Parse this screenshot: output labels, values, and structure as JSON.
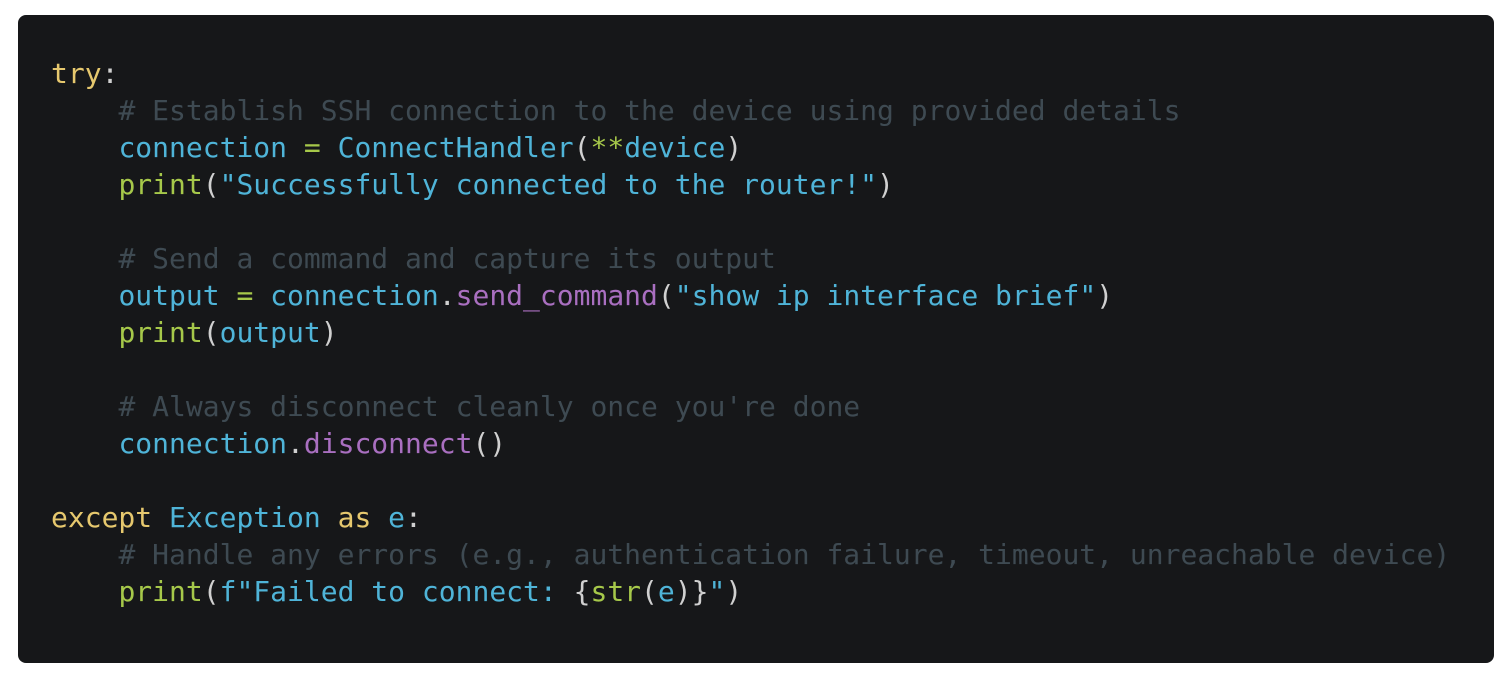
{
  "colors": {
    "background": "#161719",
    "keyword": "#e6c86e",
    "name": "#4fb4d8",
    "string": "#4fb4d8",
    "builtin": "#a6c84a",
    "operator": "#a6c84a",
    "method": "#a96fc0",
    "comment": "#3e4a52",
    "punct": "#d0d0d0"
  },
  "code": {
    "language": "python",
    "lines": [
      [
        [
          "try",
          "keyword"
        ],
        [
          ":",
          "punct"
        ]
      ],
      [
        [
          "    ",
          "punct"
        ],
        [
          "# Establish SSH connection to the device using provided details",
          "comment"
        ]
      ],
      [
        [
          "    ",
          "punct"
        ],
        [
          "connection",
          "name"
        ],
        [
          " ",
          "punct"
        ],
        [
          "=",
          "operator"
        ],
        [
          " ",
          "punct"
        ],
        [
          "ConnectHandler",
          "name"
        ],
        [
          "(",
          "punct"
        ],
        [
          "**",
          "operator"
        ],
        [
          "device",
          "name"
        ],
        [
          ")",
          "punct"
        ]
      ],
      [
        [
          "    ",
          "punct"
        ],
        [
          "print",
          "builtin"
        ],
        [
          "(",
          "punct"
        ],
        [
          "\"Successfully connected to the router!\"",
          "string"
        ],
        [
          ")",
          "punct"
        ]
      ],
      [],
      [
        [
          "    ",
          "punct"
        ],
        [
          "# Send a command and capture its output",
          "comment"
        ]
      ],
      [
        [
          "    ",
          "punct"
        ],
        [
          "output",
          "name"
        ],
        [
          " ",
          "punct"
        ],
        [
          "=",
          "operator"
        ],
        [
          " ",
          "punct"
        ],
        [
          "connection",
          "name"
        ],
        [
          ".",
          "punct"
        ],
        [
          "send_command",
          "method"
        ],
        [
          "(",
          "punct"
        ],
        [
          "\"show ip interface brief\"",
          "string"
        ],
        [
          ")",
          "punct"
        ]
      ],
      [
        [
          "    ",
          "punct"
        ],
        [
          "print",
          "builtin"
        ],
        [
          "(",
          "punct"
        ],
        [
          "output",
          "name"
        ],
        [
          ")",
          "punct"
        ]
      ],
      [],
      [
        [
          "    ",
          "punct"
        ],
        [
          "# Always disconnect cleanly once you're done",
          "comment"
        ]
      ],
      [
        [
          "    ",
          "punct"
        ],
        [
          "connection",
          "name"
        ],
        [
          ".",
          "punct"
        ],
        [
          "disconnect",
          "method"
        ],
        [
          "()",
          "punct"
        ]
      ],
      [],
      [
        [
          "except",
          "keyword"
        ],
        [
          " ",
          "punct"
        ],
        [
          "Exception",
          "name"
        ],
        [
          " ",
          "punct"
        ],
        [
          "as",
          "keyword"
        ],
        [
          " ",
          "punct"
        ],
        [
          "e",
          "name"
        ],
        [
          ":",
          "punct"
        ]
      ],
      [
        [
          "    ",
          "punct"
        ],
        [
          "# Handle any errors (e.g., authentication failure, timeout, unreachable device)",
          "comment"
        ]
      ],
      [
        [
          "    ",
          "punct"
        ],
        [
          "print",
          "builtin"
        ],
        [
          "(",
          "punct"
        ],
        [
          "f\"Failed to connect: ",
          "string"
        ],
        [
          "{",
          "punct"
        ],
        [
          "str",
          "builtin"
        ],
        [
          "(",
          "punct"
        ],
        [
          "e",
          "name"
        ],
        [
          ")",
          "punct"
        ],
        [
          "}",
          "punct"
        ],
        [
          "\"",
          "string"
        ],
        [
          ")",
          "punct"
        ]
      ]
    ]
  }
}
